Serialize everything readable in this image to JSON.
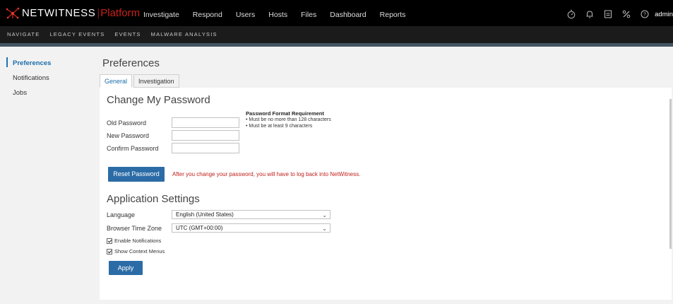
{
  "header": {
    "brand": "NETWITNESS",
    "brand_separator": "|",
    "brand_product": "Platform",
    "nav": [
      "Investigate",
      "Respond",
      "Users",
      "Hosts",
      "Files",
      "Dashboard",
      "Reports"
    ],
    "icons": [
      "timer-icon",
      "bell-icon",
      "clipboard-icon",
      "tools-icon",
      "help-icon"
    ],
    "user": "admin"
  },
  "subnav": {
    "items": [
      "NAVIGATE",
      "LEGACY EVENTS",
      "EVENTS",
      "MALWARE ANALYSIS"
    ]
  },
  "sidebar": {
    "items": [
      {
        "label": "Preferences",
        "active": true
      },
      {
        "label": "Notifications",
        "active": false
      },
      {
        "label": "Jobs",
        "active": false
      }
    ]
  },
  "main": {
    "title": "Preferences",
    "tabs": [
      {
        "label": "General",
        "active": true
      },
      {
        "label": "Investigation",
        "active": false
      }
    ]
  },
  "password": {
    "title": "Change My Password",
    "old_label": "Old Password",
    "old_value": "",
    "new_label": "New Password",
    "new_value": "",
    "confirm_label": "Confirm Password",
    "confirm_value": "",
    "req_title": "Password Format Requirement",
    "requirements": [
      "• Must be no more than 128 characters",
      "• Must be at least 9 characters"
    ],
    "reset_label": "Reset Password",
    "warning": "After you change your password, you will have to log back into NetWitness."
  },
  "app_settings": {
    "title": "Application Settings",
    "language_label": "Language",
    "language_value": "English (United States)",
    "timezone_label": "Browser Time Zone",
    "timezone_value": "UTC (GMT+00:00)",
    "enable_notifications": {
      "label": "Enable Notifications",
      "checked": true
    },
    "show_context_menus": {
      "label": "Show Context Menus",
      "checked": true
    },
    "apply_label": "Apply"
  },
  "colors": {
    "accent": "#2b6ca6",
    "brand_red": "#c8211c",
    "warning_red": "#c0201b",
    "topbar": "#000000",
    "subnav": "#1b1b1b"
  }
}
